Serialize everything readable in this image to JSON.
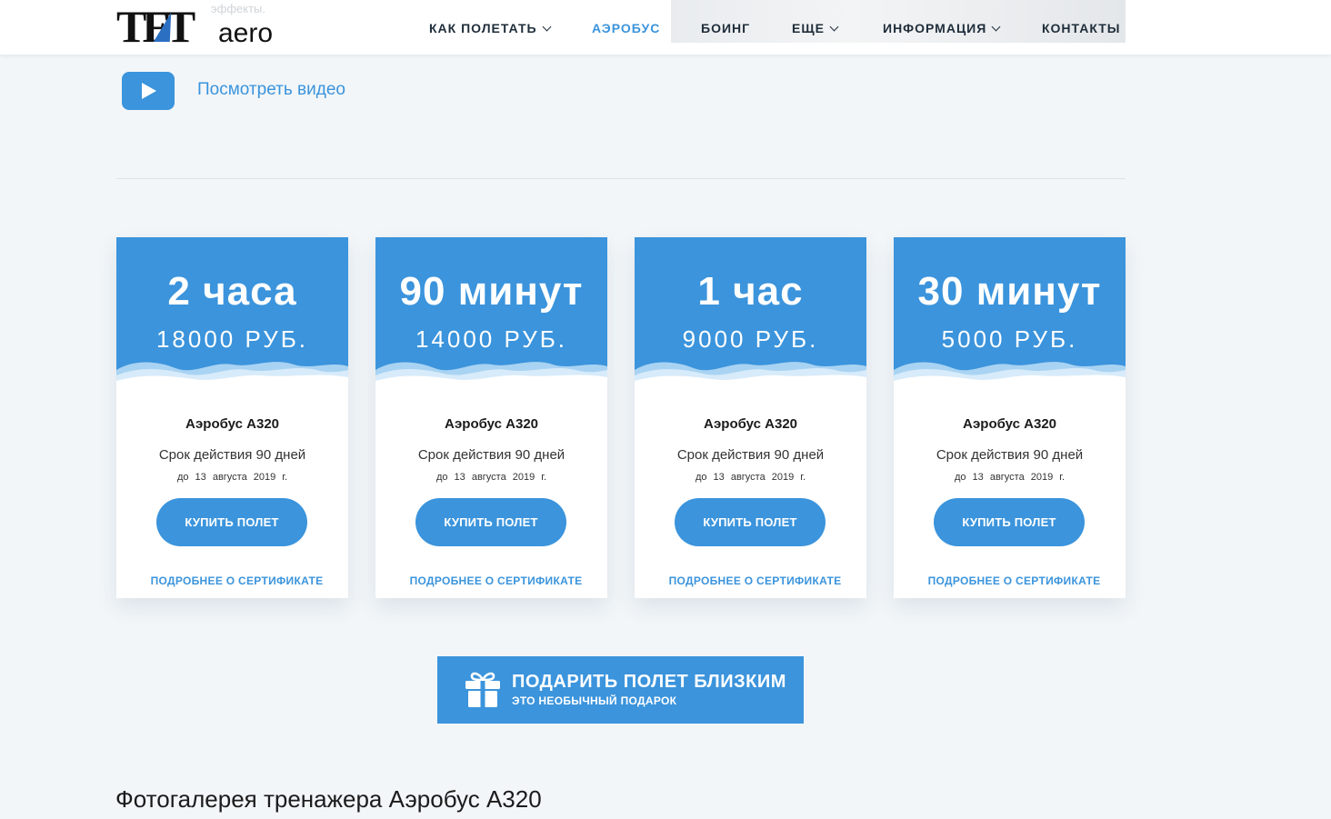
{
  "header": {
    "logo_text": "TFTaero",
    "ghost_text": "эффекты.",
    "nav": [
      {
        "label": "КАК ПОЛЕТАТЬ",
        "dropdown": true,
        "active": false
      },
      {
        "label": "АЭРОБУС",
        "dropdown": false,
        "active": true
      },
      {
        "label": "БОИНГ",
        "dropdown": false,
        "active": false
      },
      {
        "label": "ЕЩЕ",
        "dropdown": true,
        "active": false
      },
      {
        "label": "ИНФОРМАЦИЯ",
        "dropdown": true,
        "active": false
      },
      {
        "label": "КОНТАКТЫ",
        "dropdown": false,
        "active": false
      }
    ]
  },
  "video": {
    "icon": "play-icon",
    "label": "Посмотреть видео"
  },
  "cards": [
    {
      "title": "2 часа",
      "price": "18000 РУБ.",
      "model": "Аэробус А320",
      "validity": "Срок действия 90 дней",
      "date": "до 13 августа 2019 г.",
      "buy_label": "КУПИТЬ ПОЛЕТ",
      "more_label": "ПОДРОБНЕЕ О СЕРТИФИКАТЕ"
    },
    {
      "title": "90 минут",
      "price": "14000 РУБ.",
      "model": "Аэробус А320",
      "validity": "Срок действия 90 дней",
      "date": "до 13 августа 2019 г.",
      "buy_label": "КУПИТЬ ПОЛЕТ",
      "more_label": "ПОДРОБНЕЕ О СЕРТИФИКАТЕ"
    },
    {
      "title": "1 час",
      "price": "9000 РУБ.",
      "model": "Аэробус А320",
      "validity": "Срок действия 90 дней",
      "date": "до 13 августа 2019 г.",
      "buy_label": "КУПИТЬ ПОЛЕТ",
      "more_label": "ПОДРОБНЕЕ О СЕРТИФИКАТЕ"
    },
    {
      "title": "30 минут",
      "price": "5000 РУБ.",
      "model": "Аэробус А320",
      "validity": "Срок действия 90 дней",
      "date": "до 13 августа 2019 г.",
      "buy_label": "КУПИТЬ ПОЛЕТ",
      "more_label": "ПОДРОБНЕЕ О СЕРТИФИКАТЕ"
    }
  ],
  "gift": {
    "icon": "gift-icon",
    "title": "ПОДАРИТЬ ПОЛЕТ БЛИЗКИМ",
    "subtitle": "ЭТО НЕОБЫЧНЫЙ ПОДАРОК"
  },
  "gallery": {
    "title": "Фотогалерея тренажера Аэробус А320"
  },
  "colors": {
    "accent": "#3b94dc",
    "background": "#f2f6f9",
    "text": "#1b1b1b"
  }
}
